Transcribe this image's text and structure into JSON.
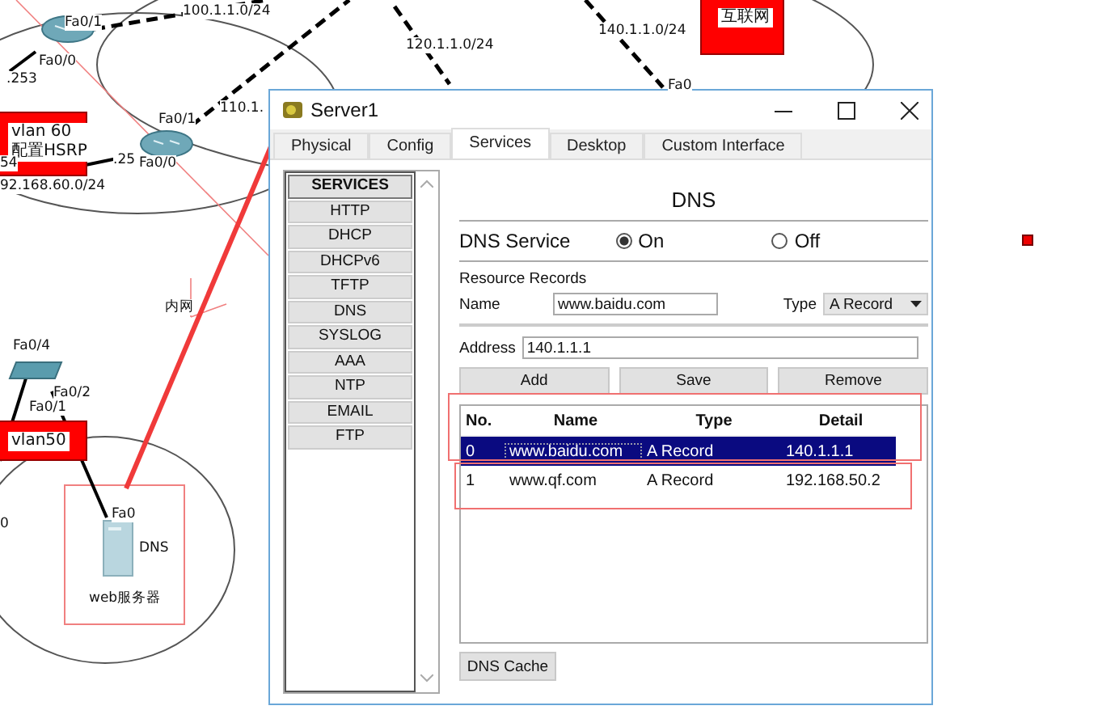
{
  "topology": {
    "labels": [
      {
        "text": "Fa0/1"
      },
      {
        "text": "100.1.1.0/24"
      },
      {
        "text": "120.1.1.0/24"
      },
      {
        "text": "140.1.1.0/24"
      },
      {
        "text": "Fa0/0"
      },
      {
        "text": ".253"
      },
      {
        "text": "Fa0"
      },
      {
        "text": "110.1."
      },
      {
        "text": "Fa0/1"
      },
      {
        "text": "54"
      },
      {
        "text": ".25"
      },
      {
        "text": "Fa0/0"
      },
      {
        "text": "92.168.60.0/24"
      },
      {
        "text": "内网"
      },
      {
        "text": "Fa0/4"
      },
      {
        "text": "Fa0/2"
      },
      {
        "text": "Fa0/1"
      },
      {
        "text": "0"
      },
      {
        "text": "Fa0"
      },
      {
        "text": "DNS"
      },
      {
        "text": "web服务器"
      }
    ],
    "areas": [
      {
        "lines": [
          "vlan 60",
          "配置HSRP"
        ]
      },
      {
        "lines": [
          "vlan50"
        ]
      },
      {
        "lines": [
          "互联网"
        ]
      }
    ]
  },
  "window": {
    "title": "Server1",
    "tabs": [
      {
        "label": "Physical",
        "selected": false
      },
      {
        "label": "Config",
        "selected": false
      },
      {
        "label": "Services",
        "selected": true
      },
      {
        "label": "Desktop",
        "selected": false
      },
      {
        "label": "Custom Interface",
        "selected": false
      }
    ],
    "services_menu": {
      "heading": "SERVICES",
      "items": [
        "HTTP",
        "DHCP",
        "DHCPv6",
        "TFTP",
        "DNS",
        "SYSLOG",
        "AAA",
        "NTP",
        "EMAIL",
        "FTP"
      ]
    },
    "dns": {
      "title": "DNS",
      "service_label": "DNS Service",
      "radios": [
        {
          "label": "On",
          "selected": true
        },
        {
          "label": "Off",
          "selected": false
        }
      ],
      "records_label": "Resource Records",
      "name_label": "Name",
      "name_value": "www.baidu.com",
      "type_label": "Type",
      "type_value": "A Record",
      "address_label": "Address",
      "address_value": "140.1.1.1",
      "buttons": [
        "Add",
        "Save",
        "Remove"
      ],
      "table": {
        "columns": [
          "No.",
          "Name",
          "Type",
          "Detail"
        ],
        "rows": [
          {
            "cells": [
              "0",
              "www.baidu.com",
              "A Record",
              "140.1.1.1"
            ],
            "selected": true
          },
          {
            "cells": [
              "1",
              "www.qf.com",
              "A Record",
              "192.168.50.2"
            ],
            "selected": false
          }
        ]
      },
      "cache_button": "DNS Cache"
    }
  }
}
